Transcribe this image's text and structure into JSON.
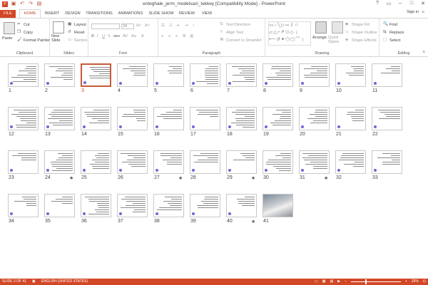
{
  "window": {
    "title": "enteghale_jerm_modelsazi_tekkey [Compatibility Mode] - PowerPoint",
    "controls": [
      "?",
      "▭",
      "–",
      "□",
      "✕"
    ]
  },
  "tabs": [
    "FILE",
    "HOME",
    "INSERT",
    "DESIGN",
    "TRANSITIONS",
    "ANIMATIONS",
    "SLIDE SHOW",
    "REVIEW",
    "VIEW"
  ],
  "active_tab": "HOME",
  "signin": "Sign in",
  "ribbon": {
    "clipboard": {
      "label": "Clipboard",
      "paste": "Paste",
      "cut": "Cut",
      "copy": "Copy",
      "format_painter": "Format Painter"
    },
    "slides": {
      "label": "Slides",
      "new_slide": "New Slide",
      "layout": "Layout",
      "reset": "Reset",
      "section": "Section"
    },
    "font": {
      "label": "Font",
      "size": "24"
    },
    "paragraph": {
      "label": "Paragraph",
      "text_direction": "Text Direction",
      "align_text": "Align Text",
      "convert": "Convert to SmartArt"
    },
    "drawing": {
      "label": "Drawing",
      "arrange": "Arrange",
      "quick_styles": "Quick Styles",
      "shape_fill": "Shape Fill",
      "shape_outline": "Shape Outline",
      "shape_effects": "Shape Effects"
    },
    "editing": {
      "label": "Editing",
      "find": "Find",
      "replace": "Replace",
      "select": "Select"
    }
  },
  "slides": [
    {
      "n": "1"
    },
    {
      "n": "2"
    },
    {
      "n": "3",
      "selected": true
    },
    {
      "n": "4"
    },
    {
      "n": "5"
    },
    {
      "n": "6"
    },
    {
      "n": "7"
    },
    {
      "n": "8"
    },
    {
      "n": "9"
    },
    {
      "n": "10"
    },
    {
      "n": "11"
    },
    {
      "n": "12"
    },
    {
      "n": "13"
    },
    {
      "n": "14"
    },
    {
      "n": "15"
    },
    {
      "n": "16"
    },
    {
      "n": "17"
    },
    {
      "n": "18"
    },
    {
      "n": "19"
    },
    {
      "n": "20"
    },
    {
      "n": "21"
    },
    {
      "n": "22"
    },
    {
      "n": "23"
    },
    {
      "n": "24",
      "star": true
    },
    {
      "n": "25"
    },
    {
      "n": "26"
    },
    {
      "n": "27",
      "star": true
    },
    {
      "n": "28"
    },
    {
      "n": "29",
      "star": true
    },
    {
      "n": "30"
    },
    {
      "n": "31",
      "star": true
    },
    {
      "n": "32"
    },
    {
      "n": "33"
    },
    {
      "n": "34"
    },
    {
      "n": "35"
    },
    {
      "n": "36"
    },
    {
      "n": "37"
    },
    {
      "n": "38"
    },
    {
      "n": "39"
    },
    {
      "n": "40",
      "star": true
    },
    {
      "n": "41",
      "photo": true
    }
  ],
  "star_glyph": "★",
  "status": {
    "slide_info": "SLIDE 3 OF 41",
    "language": "ENGLISH (UNITED STATES)",
    "zoom": "33%",
    "zoom_minus": "–",
    "zoom_plus": "+"
  },
  "colors": {
    "accent": "#d24726",
    "selected_border": "#c85a3a"
  }
}
